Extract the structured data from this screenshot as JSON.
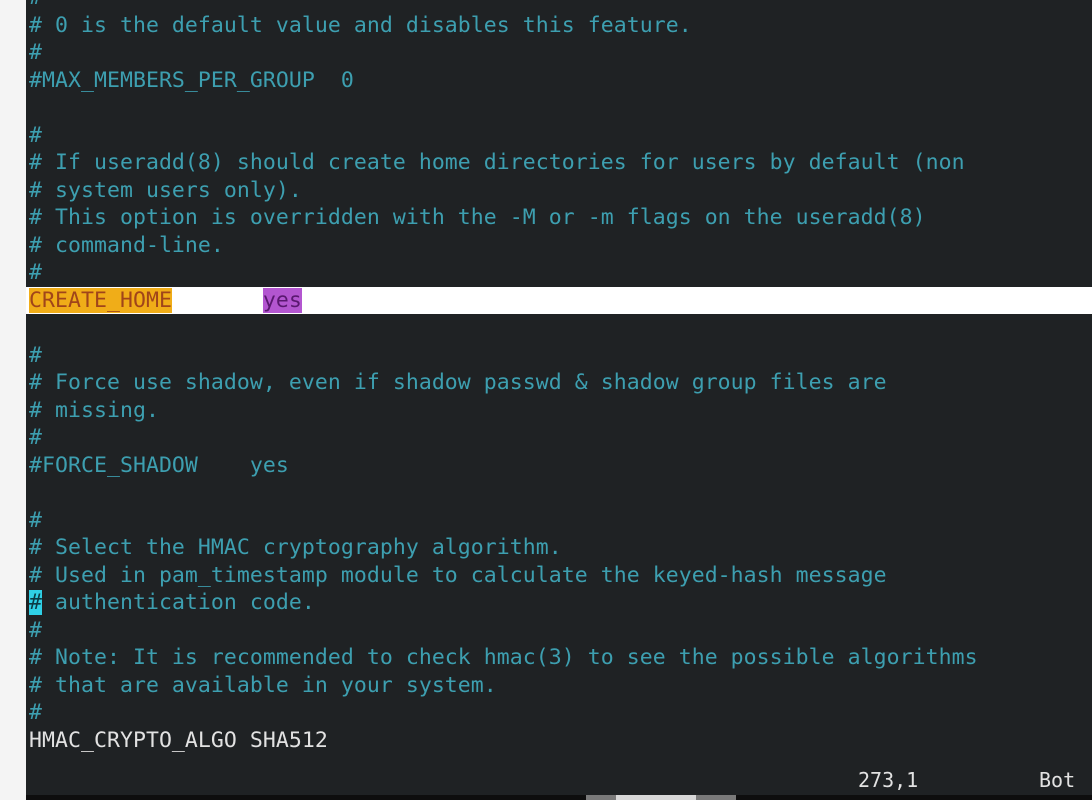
{
  "editor": {
    "lines": [
      {
        "text": "#",
        "kind": "comment"
      },
      {
        "text": "# 0 is the default value and disables this feature.",
        "kind": "comment"
      },
      {
        "text": "#",
        "kind": "comment"
      },
      {
        "text": "#MAX_MEMBERS_PER_GROUP  0",
        "kind": "comment"
      },
      {
        "text": "",
        "kind": "comment"
      },
      {
        "text": "#",
        "kind": "comment"
      },
      {
        "text": "# If useradd(8) should create home directories for users by default (non",
        "kind": "comment"
      },
      {
        "text": "# system users only).",
        "kind": "comment"
      },
      {
        "text": "# This option is overridden with the -M or -m flags on the useradd(8)",
        "kind": "comment"
      },
      {
        "text": "# command-line.",
        "kind": "comment"
      },
      {
        "text": "#",
        "kind": "comment"
      },
      {
        "key": "CREATE_HOME",
        "gap": "       ",
        "value": "yes",
        "kind": "setting-highlighted"
      },
      {
        "text": "",
        "kind": "comment"
      },
      {
        "text": "#",
        "kind": "comment"
      },
      {
        "text": "# Force use shadow, even if shadow passwd & shadow group files are",
        "kind": "comment"
      },
      {
        "text": "# missing.",
        "kind": "comment"
      },
      {
        "text": "#",
        "kind": "comment"
      },
      {
        "text": "#FORCE_SHADOW    yes",
        "kind": "comment"
      },
      {
        "text": "",
        "kind": "comment"
      },
      {
        "text": "#",
        "kind": "comment"
      },
      {
        "text": "# Select the HMAC cryptography algorithm.",
        "kind": "comment"
      },
      {
        "text": "# Used in pam_timestamp module to calculate the keyed-hash message",
        "kind": "comment"
      },
      {
        "cursor_char": "#",
        "text": " authentication code.",
        "kind": "cursor"
      },
      {
        "text": "#",
        "kind": "comment"
      },
      {
        "text": "# Note: It is recommended to check hmac(3) to see the possible algorithms",
        "kind": "comment"
      },
      {
        "text": "# that are available in your system.",
        "kind": "comment"
      },
      {
        "text": "#",
        "kind": "comment"
      },
      {
        "text": "HMAC_CRYPTO_ALGO SHA512",
        "kind": "plain"
      }
    ]
  },
  "status": {
    "position": "273,1",
    "scroll": "Bot"
  },
  "colors": {
    "background": "#1f2224",
    "comment": "#3d9fb0",
    "plain": "#e2e2e2",
    "search_key_bg": "#f0ad18",
    "search_value_bg": "#b356d0",
    "cursor": "#2fd0e6",
    "cursorline": "#ffffff"
  }
}
